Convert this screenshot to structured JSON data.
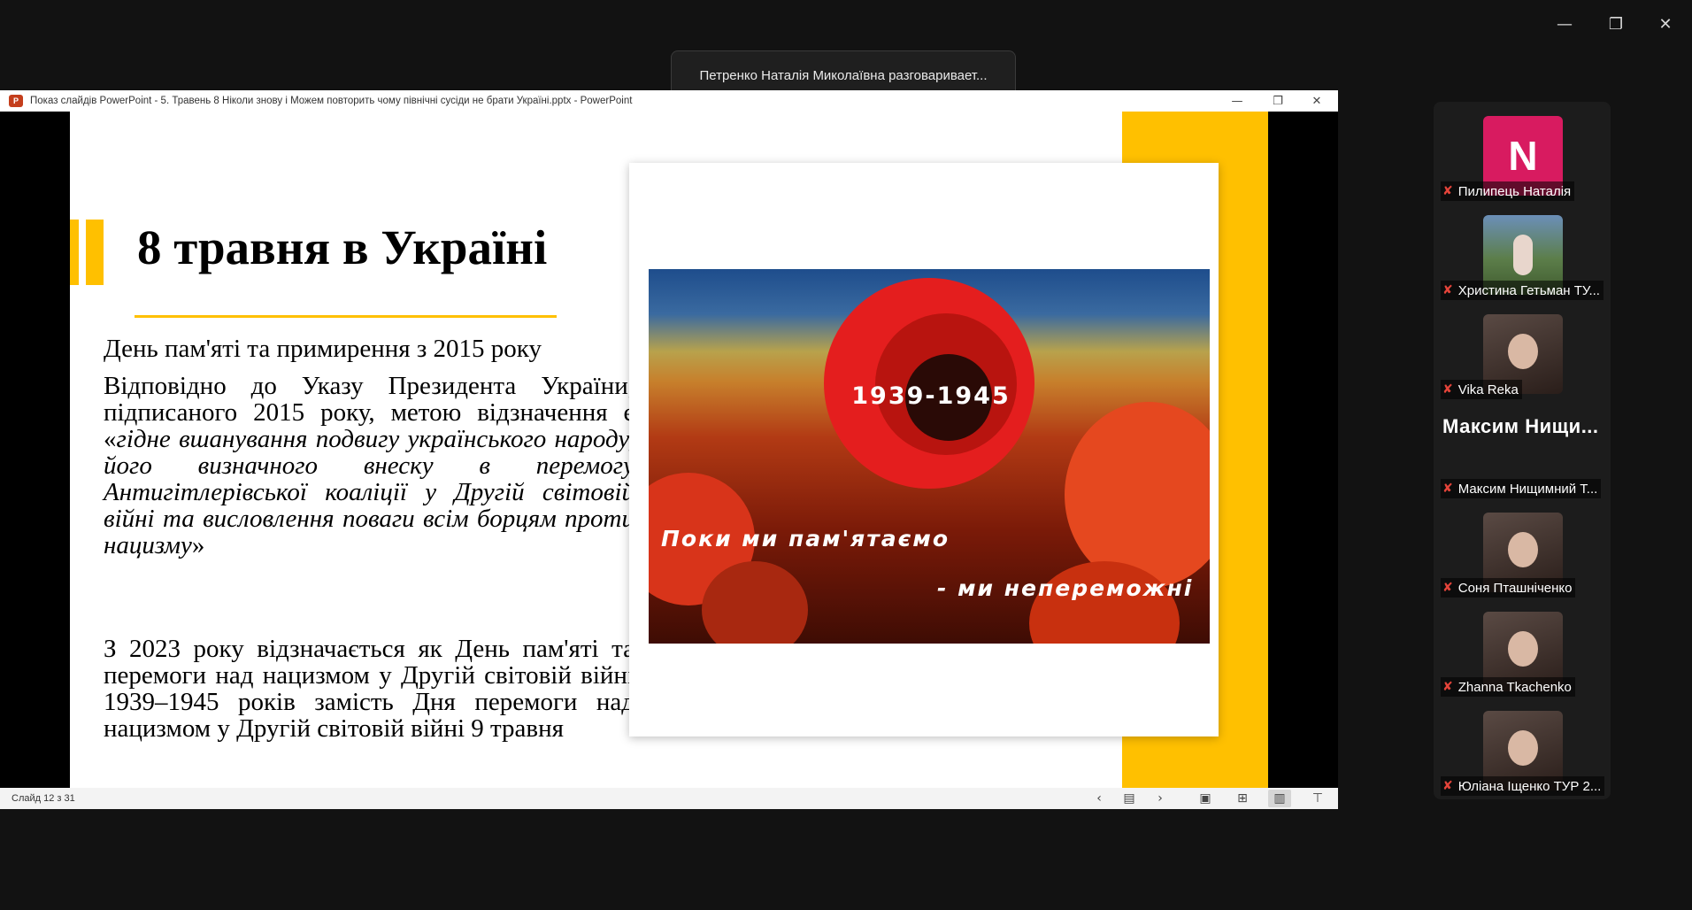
{
  "window": {
    "minimize_icon": "minimize-icon",
    "restore_icon": "restore-icon",
    "close_icon": "close-icon"
  },
  "speaking_banner": "Петренко Наталія Миколаївна разговаривает...",
  "ppt": {
    "title": "Показ слайдів PowerPoint  -  5. Травень 8 Ніколи знову і Можем повторить чому північні сусіди не брати Україні.pptx - PowerPoint",
    "slide_counter": "Слайд 12 з 31"
  },
  "slide": {
    "title": "8 травня в Україні",
    "line1": "День пам'яті та примирення з 2015 року",
    "para1_plain": "Відповідно до Указу Президента України, підписаного 2015 року, метою відзначення є «",
    "para1_italic": "гідне вшанування подвигу українського народу, його визначного внеску в перемогу Антигітлерівської коаліції у Другій світовій війні та висловлення поваги всім борцям проти нацизму",
    "para1_end": "»",
    "para2": "З 2023 року відзначається як День пам'яті та перемоги над нацизмом у Другій світовій війні 1939–1945 років замість Дня перемоги над нацизмом у Другій світовій війні 9 травня",
    "image_years": "1939-1945",
    "image_caption1": "Поки ми пам'ятаємо",
    "image_caption2": "- ми непереможні"
  },
  "colors": {
    "accent_yellow": "#ffc000",
    "avatar_pink": "#d81b60",
    "muted_mic": "#e5443a"
  },
  "participants": [
    {
      "name": "Пилипець Наталія",
      "avatar": "N"
    },
    {
      "name": "Христина Гетьман ТУ..."
    },
    {
      "name": "Vika Reka"
    },
    {
      "name": "Максим Нищимний Т...",
      "display": "Максим Нищи..."
    },
    {
      "name": "Соня Пташніченко"
    },
    {
      "name": "Zhanna Tkachenko"
    },
    {
      "name": "Юліана Іщенко ТУР 2..."
    }
  ]
}
